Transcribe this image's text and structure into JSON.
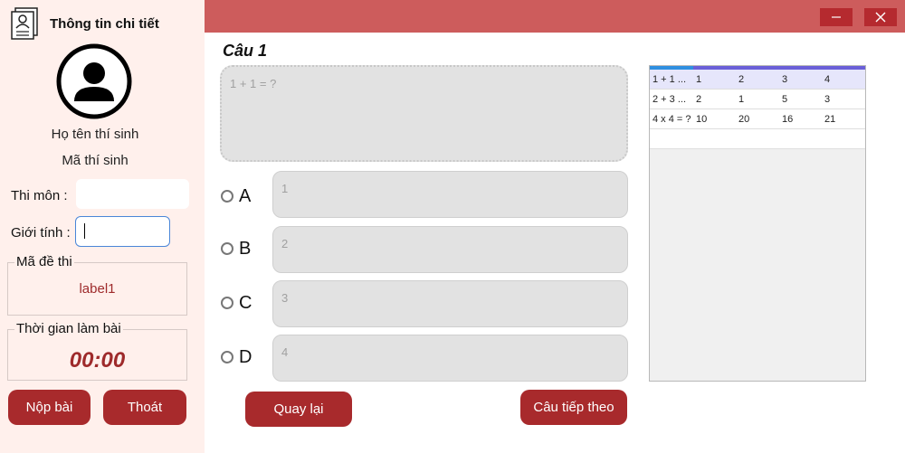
{
  "sidebar": {
    "header_title": "Thông tin chi tiết",
    "candidate_name": "Họ tên thí sinh",
    "candidate_id": "Mã thí sinh",
    "subject_label": "Thi môn :",
    "subject_value": "",
    "gender_label": "Giới tính :",
    "gender_value": "",
    "exam_code_title": "Mã đề thi",
    "exam_code_value": "label1",
    "time_title": "Thời gian làm bài",
    "time_value": "00:00",
    "submit_label": "Nộp bài",
    "exit_label": "Thoát"
  },
  "window": {
    "minimize_icon": "minimize-icon",
    "close_icon": "close-icon",
    "titlebar_color": "#cd5c5c"
  },
  "question": {
    "title": "Câu 1",
    "text": "1 + 1 = ?",
    "options": [
      {
        "letter": "A",
        "text": "1"
      },
      {
        "letter": "B",
        "text": "2"
      },
      {
        "letter": "C",
        "text": "3"
      },
      {
        "letter": "D",
        "text": "4"
      }
    ]
  },
  "nav": {
    "back_label": "Quay lại",
    "next_label": "Câu tiếp theo"
  },
  "grid": {
    "rows": [
      [
        "1 + 1 ...",
        "1",
        "2",
        "3",
        "4"
      ],
      [
        "2 + 3 ...",
        "2",
        "1",
        "5",
        "3"
      ],
      [
        "4 x 4 = ?",
        "10",
        "20",
        "16",
        "21"
      ]
    ]
  },
  "colors": {
    "accent": "#a82a2c",
    "sidebar_bg": "#fff0ec",
    "selected_row": "#e6e6fb"
  }
}
